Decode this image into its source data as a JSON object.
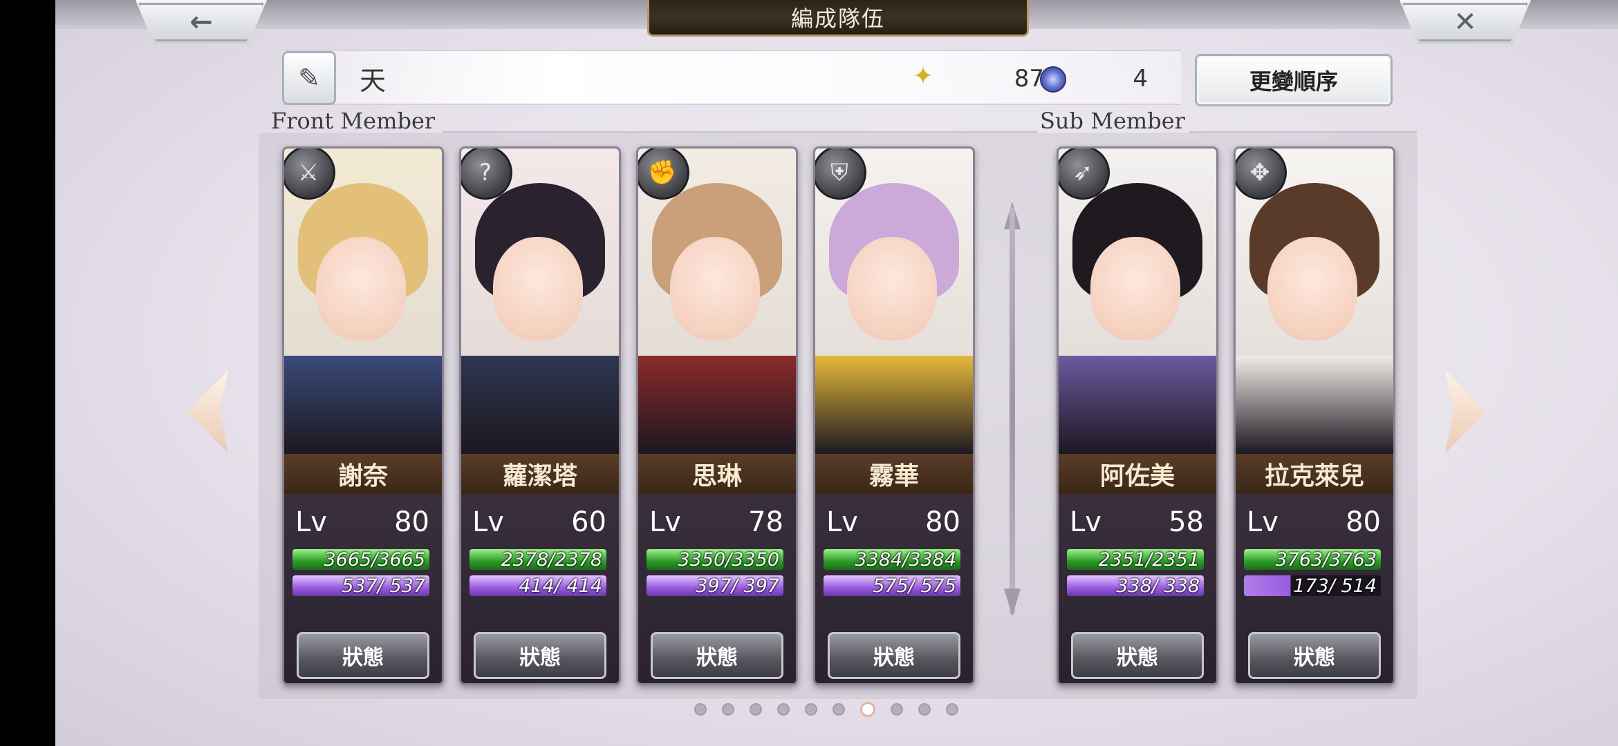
{
  "header": {
    "title": "編成隊伍",
    "back_icon": "←",
    "close_icon": "✕"
  },
  "team": {
    "name": "天",
    "wing_icon": "✦",
    "wing_value": "87",
    "swirl_value": "4",
    "order_button": "更變順序"
  },
  "sections": {
    "front": "Front Member",
    "sub": "Sub Member"
  },
  "status_label": "狀態",
  "lv_label": "Lv",
  "cards": [
    {
      "name": "謝奈",
      "lv": "80",
      "hp": "3665/3665",
      "mp": " 537/  537",
      "class_icon": "⚔",
      "class": "sword",
      "hair": "#e3c07a",
      "cloth": "#3a4a7a",
      "bg": "#f3ead5"
    },
    {
      "name": "蘿潔塔",
      "lv": "60",
      "hp": "2378/2378",
      "mp": " 414/  414",
      "class_icon": "?",
      "class": "staff",
      "hair": "#2b2230",
      "cloth": "#2f3650",
      "bg": "#f4e8e8"
    },
    {
      "name": "思琳",
      "lv": "78",
      "hp": "3350/3350",
      "mp": " 397/  397",
      "class_icon": "✊",
      "class": "fist",
      "hair": "#c9a07a",
      "cloth": "#8a2a2a",
      "bg": "#f2ece4"
    },
    {
      "name": "霧華",
      "lv": "80",
      "hp": "3384/3384",
      "mp": " 575/  575",
      "class_icon": "⛨",
      "class": "shield",
      "hair": "#cba9d8",
      "cloth": "#e6b93a",
      "bg": "#f5f2ef"
    },
    {
      "name": "阿佐美",
      "lv": "58",
      "hp": "2351/2351",
      "mp": " 338/  338",
      "class_icon": "➶",
      "class": "spear",
      "hair": "#1e1a20",
      "cloth": "#6a5aa0",
      "bg": "#f2f0f0"
    },
    {
      "name": "拉克萊兒",
      "lv": "80",
      "hp": "3763/3763",
      "mp": " 173/  514",
      "class_icon": "✥",
      "class": "bow",
      "hair": "#5a3a28",
      "cloth": "#f0ede8",
      "bg": "#f6f4f2",
      "mp_partial": true
    }
  ],
  "pagination": {
    "total": 10,
    "active_index": 6
  }
}
